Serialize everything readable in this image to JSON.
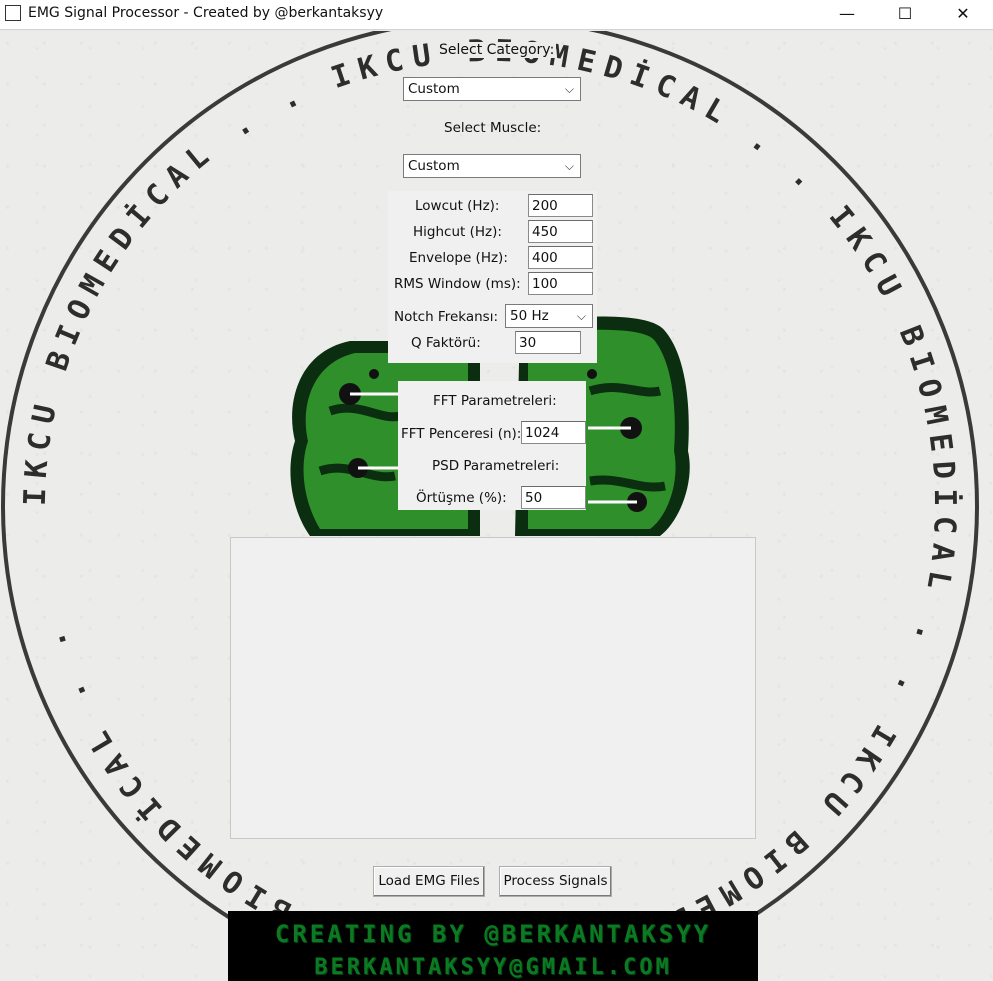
{
  "window": {
    "title": "EMG Signal Processor - Created by @berkantaksyy",
    "minimize": "—",
    "maximize": "☐",
    "close": "✕"
  },
  "category": {
    "label": "Select Category:",
    "selected": "Custom"
  },
  "muscle": {
    "label": "Select Muscle:",
    "selected": "Custom"
  },
  "filters": {
    "lowcut_label": "Lowcut (Hz):",
    "lowcut_value": "200",
    "highcut_label": "Highcut (Hz):",
    "highcut_value": "450",
    "envelope_label": "Envelope (Hz):",
    "envelope_value": "400",
    "rms_label": "RMS Window (ms):",
    "rms_value": "100",
    "notch_label": "Notch Frekansı:",
    "notch_selected": "50 Hz",
    "q_label": "Q Faktörü:",
    "q_value": "30"
  },
  "fft": {
    "title": "FFT Parametreleri:",
    "window_label": "FFT Penceresi (n):",
    "window_value": "1024"
  },
  "psd": {
    "title": "PSD Parametreleri:",
    "overlap_label": "Örtüşme (%):",
    "overlap_value": "50"
  },
  "buttons": {
    "load": "Load EMG Files",
    "process": "Process Signals"
  },
  "logo": {
    "ring_text": "IKCU BIOMEDİCAL . . IKCU BIOMEDİCAL . . IKCU BIOMEDİCAL . . IKCU BIOMEDİCAL . . IKCU BIOMEDİCAL . .",
    "accent": "#2f8f2a",
    "dark": "#0b2e10"
  },
  "credits": {
    "line1": "CREATING BY @BERKANTAKSYY",
    "line2": "BERKANTAKSYY@GMAIL.COM"
  }
}
